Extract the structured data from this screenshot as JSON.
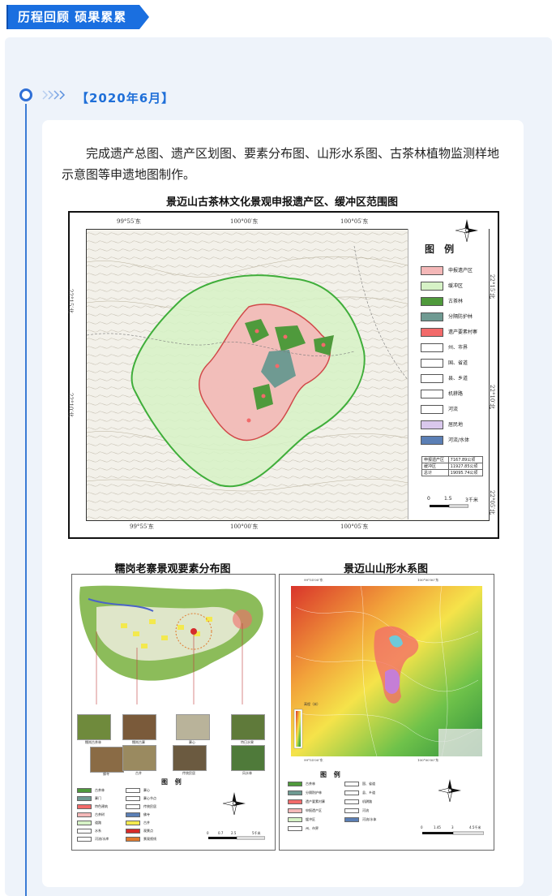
{
  "header": {
    "title": "历程回顾 硕果累累",
    "accent_color": "#1a6fe0"
  },
  "timeline": {
    "date": "【2020年6月】",
    "line_color": "#3a7bd5"
  },
  "intro_text": "完成遗产总图、遗产区划图、要素分布图、山形水系图、古茶林植物监测样地示意图等申遗地图制作。",
  "main_map": {
    "title": "景迈山古茶林文化景观申报遗产区、缓冲区范围图",
    "top_coords": [
      "99°55′东",
      "100°00′东",
      "100°05′东"
    ],
    "bottom_coords": [
      "99°55′东",
      "100°00′东",
      "100°05′东"
    ],
    "left_coords": [
      "22°15′北",
      "22°10′北"
    ],
    "right_coords": [
      "22°15′北",
      "22°10′北",
      "22°05′北"
    ],
    "legend_title": "图 例",
    "legend": [
      {
        "label": "申报遗产区",
        "color": "#f4b8b8"
      },
      {
        "label": "缓冲区",
        "color": "#d6f2c6"
      },
      {
        "label": "古茶林",
        "color": "#4f9a3c"
      },
      {
        "label": "分隔防护林",
        "color": "#6f9a92"
      },
      {
        "label": "遗产要素村寨",
        "color": "#f26a6a"
      },
      {
        "label": "州、市界",
        "color": "#ffffff"
      },
      {
        "label": "国、省道",
        "color": "#ffffff"
      },
      {
        "label": "县、乡道",
        "color": "#ffffff"
      },
      {
        "label": "机耕路",
        "color": "#ffffff"
      },
      {
        "label": "河流",
        "color": "#ffffff"
      },
      {
        "label": "居民地",
        "color": "#d9c8ec"
      },
      {
        "label": "河流/水体",
        "color": "#5b7fb5"
      }
    ],
    "area_table": [
      [
        "申报遗产区",
        "7167.89公顷"
      ],
      [
        "缓冲区",
        "11927.85公顷"
      ],
      [
        "总计",
        "19095.74公顷"
      ]
    ],
    "scale": [
      "0",
      "1.5",
      "3千米"
    ],
    "north_label": "N"
  },
  "left_map": {
    "title": "糯岗老寨景观要素分布图",
    "photos": [
      "糯岗古茶林",
      "糯岗古寨",
      "寨心",
      "特日水果",
      "佛寺",
      "古井",
      "传统民居",
      "风水林"
    ],
    "legend_title": "图 例",
    "legend": [
      "古茶林",
      "寨门",
      "特色建筑",
      "古茶树",
      "道路",
      "水系",
      "河流/水库",
      "寨心",
      "寨心节点",
      "传统民居",
      "佛寺",
      "古井",
      "观景点",
      "景观视线"
    ],
    "scale": [
      "0",
      "0.7",
      "2.5",
      "5千米"
    ]
  },
  "right_map": {
    "title": "景迈山山形水系图",
    "top_coords": [
      "99°55′00″东",
      "100°00′00″东"
    ],
    "bottom_coords": [
      "99°55′00″东",
      "100°00′00″东"
    ],
    "legend_title": "图 例",
    "legend": [
      "古茶林",
      "分隔防护林",
      "遗产要素村寨",
      "申报遗产区",
      "缓冲区",
      "州、市界",
      "国、省道",
      "县、乡道",
      "机耕路",
      "河流",
      "河流/水体"
    ],
    "elevation_label": "高程（米）",
    "scale": [
      "0",
      "1.45",
      "3",
      "4.5千米"
    ]
  }
}
